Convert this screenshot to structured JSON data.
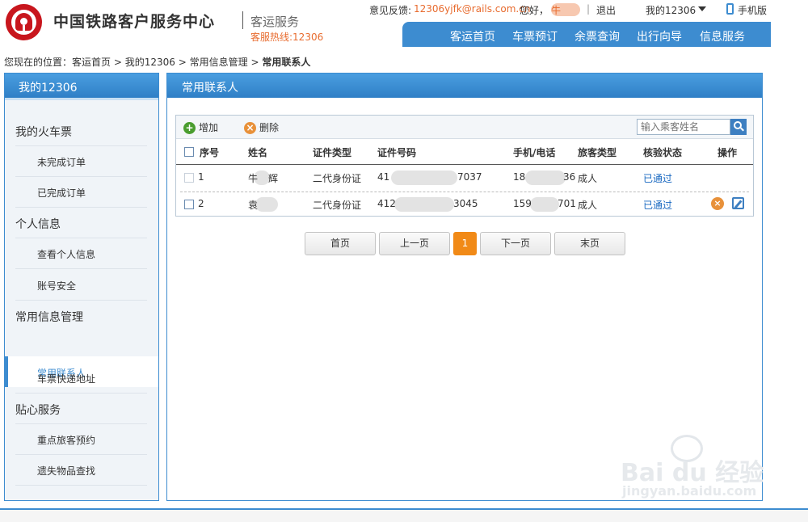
{
  "header": {
    "site_title": "中国铁路客户服务中心",
    "subtitle": "客运服务",
    "hotline": "客服热线:12306",
    "feedback_label": "意见反馈:",
    "feedback_email": "12306yjfk@rails.com.cn",
    "greeting": "您好，",
    "greeting_name": "牛",
    "divider": "|",
    "logout": "退出",
    "my_account": "我的12306",
    "mobile": "手机版"
  },
  "nav": {
    "items": [
      "客运首页",
      "车票预订",
      "余票查询",
      "出行向导",
      "信息服务"
    ]
  },
  "breadcrumb": {
    "prefix": "您现在的位置：",
    "items": [
      "客运首页",
      "我的12306",
      "常用信息管理",
      "常用联系人"
    ],
    "sep": ">"
  },
  "sidebar": {
    "title": "我的12306",
    "groups": [
      {
        "label": "我的火车票",
        "items": [
          "未完成订单",
          "已完成订单"
        ]
      },
      {
        "label": "个人信息",
        "items": [
          "查看个人信息",
          "账号安全"
        ]
      },
      {
        "label": "常用信息管理",
        "items": [
          "常用联系人",
          "车票快递地址"
        ]
      },
      {
        "label": "贴心服务",
        "items": [
          "重点旅客预约",
          "遗失物品查找"
        ]
      }
    ],
    "active_item": "常用联系人"
  },
  "main": {
    "title": "常用联系人",
    "toolbar": {
      "add": "增加",
      "delete": "删除",
      "search_placeholder": "输入乘客姓名"
    },
    "columns": [
      "序号",
      "姓名",
      "证件类型",
      "证件号码",
      "手机/电话",
      "旅客类型",
      "核验状态",
      "操作"
    ],
    "rows": [
      {
        "no": "1",
        "name_a": "牛",
        "name_b": "辉",
        "id_type": "二代身份证",
        "id_a": "41",
        "id_b": "7037",
        "phone_a": "18",
        "phone_b": "36",
        "type": "成人",
        "status": "已通过"
      },
      {
        "no": "2",
        "name_a": "袁",
        "name_b": "",
        "id_type": "二代身份证",
        "id_a": "412",
        "id_b": "3045",
        "phone_a": "159",
        "phone_b": "701",
        "type": "成人",
        "status": "已通过"
      }
    ],
    "pagination": {
      "first": "首页",
      "prev": "上一页",
      "current": "1",
      "next": "下一页",
      "last": "末页"
    }
  },
  "watermark": {
    "text": "Bai du 经验",
    "url": "jingyan.baidu.com"
  },
  "colors": {
    "brand_blue": "#3d8cd0",
    "accent_orange": "#e86b2e",
    "logo_red": "#c8161d"
  }
}
